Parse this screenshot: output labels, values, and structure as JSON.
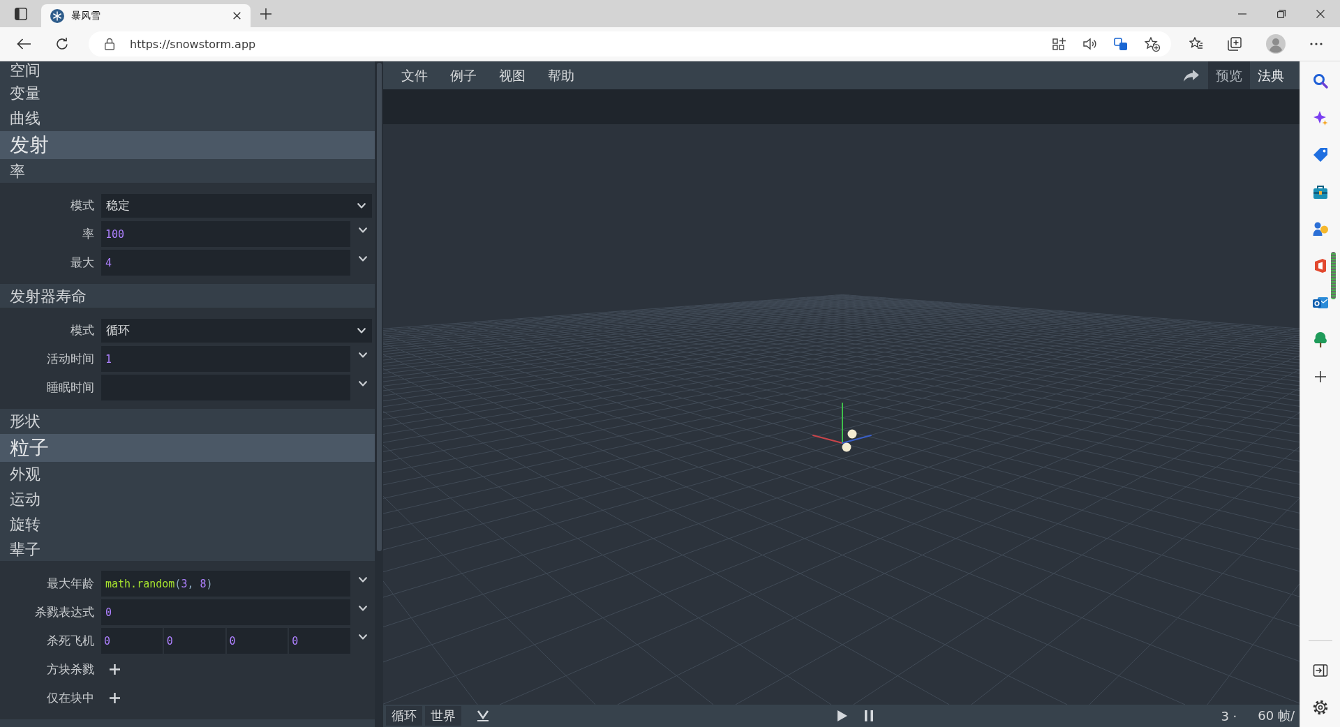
{
  "browser": {
    "tab_title": "暴风雪",
    "url": "https://snowstorm.app"
  },
  "sidebar": {
    "groups": [
      {
        "sections": [
          {
            "title": "空间",
            "expanded": false
          },
          {
            "title": "变量",
            "expanded": false
          },
          {
            "title": "曲线",
            "expanded": false
          }
        ]
      },
      {
        "title": "发射",
        "sections": [
          {
            "title": "率",
            "expanded": true,
            "fields": [
              {
                "kind": "select",
                "label": "模式",
                "value": "稳定"
              },
              {
                "kind": "expression",
                "label": "率",
                "value": "100"
              },
              {
                "kind": "expression",
                "label": "最大",
                "value": "4"
              }
            ]
          },
          {
            "title": "发射器寿命",
            "expanded": true,
            "fields": [
              {
                "kind": "select",
                "label": "模式",
                "value": "循环"
              },
              {
                "kind": "expression",
                "label": "活动时间",
                "value": "1"
              },
              {
                "kind": "expression",
                "label": "睡眠时间"
              }
            ]
          },
          {
            "title": "形状",
            "expanded": false
          }
        ]
      },
      {
        "title": "粒子",
        "sections": [
          {
            "title": "外观",
            "expanded": false
          },
          {
            "title": "运动",
            "expanded": false
          },
          {
            "title": "旋转",
            "expanded": false
          },
          {
            "title": "辈子",
            "expanded": true,
            "fields": [
              {
                "kind": "expression",
                "label": "最大年龄",
                "value": "math.random(3, 8)"
              },
              {
                "kind": "expression",
                "label": "杀戮表达式",
                "value": "0"
              },
              {
                "kind": "vector",
                "label": "杀死飞机",
                "values": [
                  "0",
                  "0",
                  "0",
                  "0"
                ]
              },
              {
                "kind": "list",
                "label": "方块杀戮"
              },
              {
                "kind": "list",
                "label": "仅在块中"
              }
            ]
          }
        ]
      }
    ]
  },
  "menu": [
    "文件",
    "例子",
    "视图",
    "帮助"
  ],
  "view_tabs": [
    {
      "label": "预览",
      "selected": true
    },
    {
      "label": "法典",
      "selected": false
    }
  ],
  "bottom_bar": {
    "buttons": [
      "循环",
      "世界"
    ],
    "particle_count": "3 ·",
    "frame_rate": "60 帧/"
  }
}
